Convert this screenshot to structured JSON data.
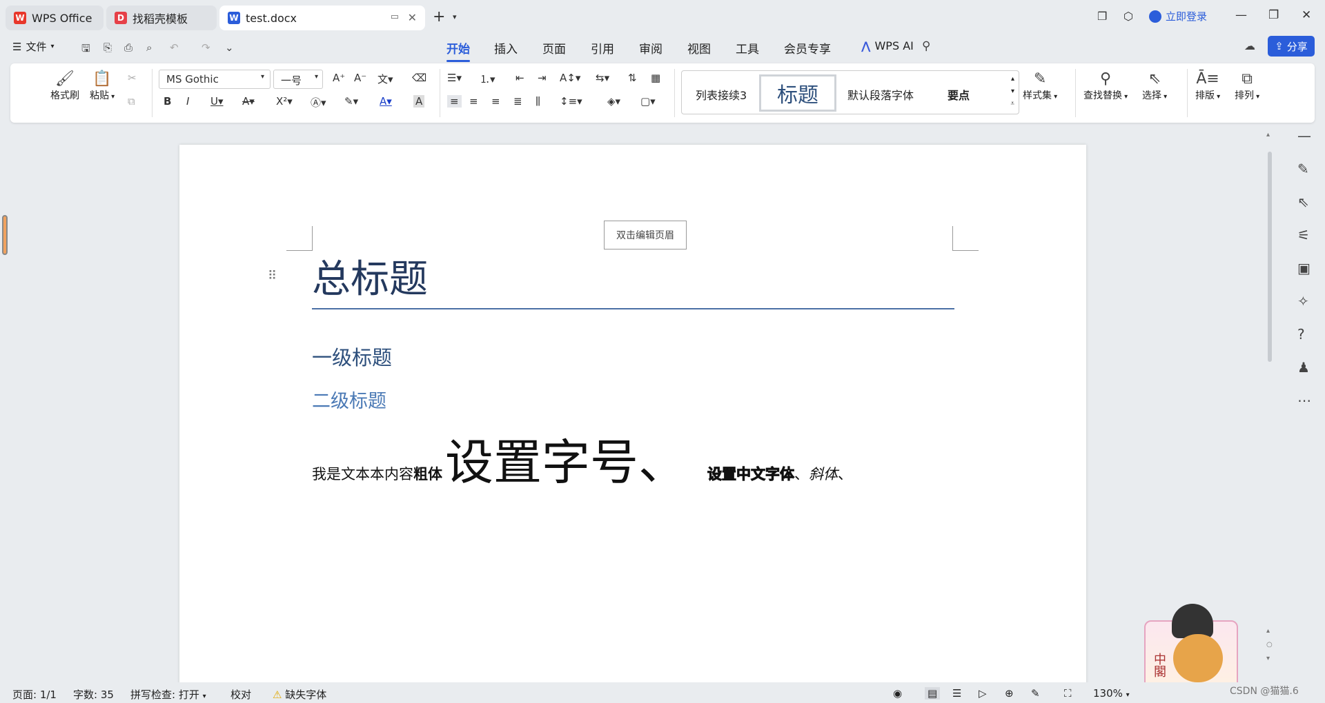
{
  "tabs": [
    {
      "label": "WPS Office",
      "icon": "wps-logo-icon",
      "color": "#e8372b"
    },
    {
      "label": "找稻壳模板",
      "icon": "docer-icon",
      "color": "#e64048"
    },
    {
      "label": "test.docx",
      "icon": "word-doc-icon",
      "color": "#2b5dda"
    }
  ],
  "account": {
    "login_label": "立即登录"
  },
  "menu": {
    "file_label": "文件",
    "tabs": [
      "开始",
      "插入",
      "页面",
      "引用",
      "审阅",
      "视图",
      "工具",
      "会员专享"
    ],
    "active_tab": "开始",
    "wps_ai_label": "WPS AI",
    "share_label": "分享"
  },
  "ribbon": {
    "format_painter": "格式刷",
    "paste": "粘贴",
    "font_name": "MS Gothic",
    "font_size": "一号",
    "styles": [
      "列表接续3",
      "标题",
      "默认段落字体",
      "要点"
    ],
    "style_set": "样式集",
    "find_replace": "查找替换",
    "select": "选择",
    "typeset": "排版",
    "arrange": "排列"
  },
  "document": {
    "header_button": "双击编辑页眉",
    "title": "总标题",
    "heading1": "一级标题",
    "heading2": "二级标题",
    "text_plain": "我是文本本内容",
    "text_bold": "粗体",
    "text_big": "设置字号、",
    "text_outline": "设置中文字体",
    "text_sep": "、",
    "text_italic": "斜体",
    "text_end": "、"
  },
  "status": {
    "page": "页面: 1/1",
    "words": "字数: 35",
    "spell": "拼写检查: 打开",
    "proof": "校对",
    "missing_font": "缺失字体",
    "zoom": "130%"
  },
  "watermark": "CSDN @猫猫.6",
  "sticker_text": "中閣"
}
